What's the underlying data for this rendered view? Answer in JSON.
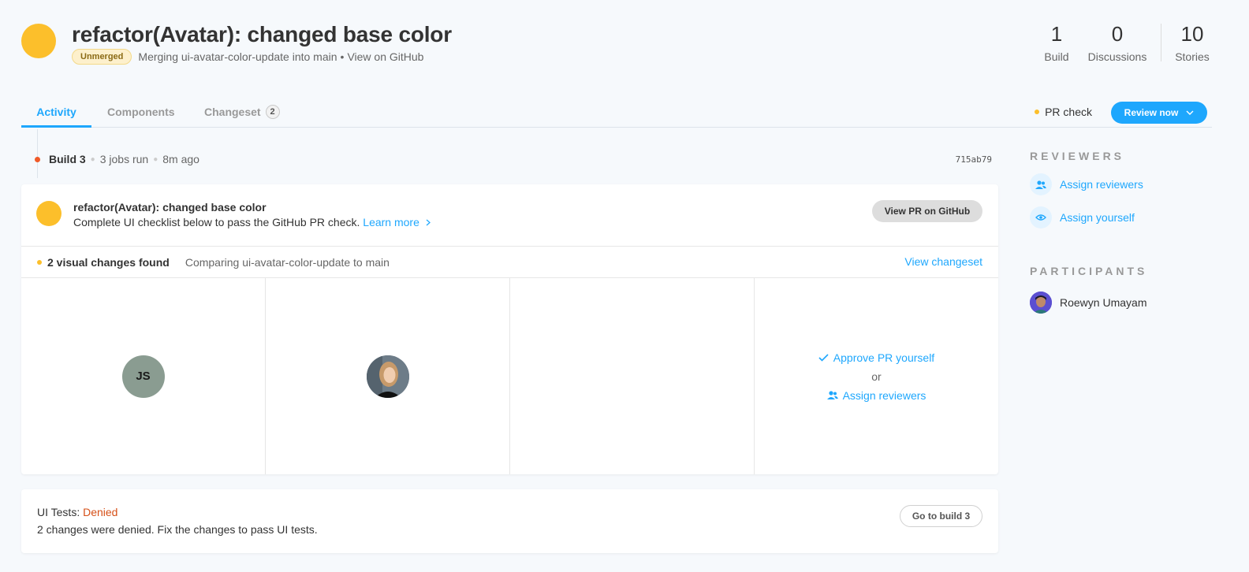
{
  "header": {
    "title": "refactor(Avatar): changed base color",
    "status_badge": "Unmerged",
    "merge_text": "Merging ui-avatar-color-update into main",
    "separator": "•",
    "github_link": "View on GitHub",
    "status_color": "#fcbf2b"
  },
  "stats": [
    {
      "value": "1",
      "label": "Build"
    },
    {
      "value": "0",
      "label": "Discussions"
    },
    {
      "value": "10",
      "label": "Stories"
    }
  ],
  "tabs": [
    {
      "label": "Activity",
      "active": true
    },
    {
      "label": "Components",
      "active": false
    },
    {
      "label": "Changeset",
      "active": false,
      "count": "2"
    }
  ],
  "toolbar": {
    "pr_check_label": "PR check",
    "review_button": "Review now"
  },
  "timeline": {
    "build_name": "Build 3",
    "jobs": "3 jobs run",
    "time": "8m ago",
    "commit_hash": "715ab79"
  },
  "pr_card": {
    "title": "refactor(Avatar): changed base color",
    "description": "Complete UI checklist below to pass the GitHub PR check.",
    "learn_more": "Learn more",
    "view_pr_button": "View PR on GitHub",
    "changes_found": "2 visual changes found",
    "comparison": "Comparing ui-avatar-color-update to main",
    "view_changeset": "View changeset",
    "avatar_initials": "JS",
    "approve_link": "Approve PR yourself",
    "or_text": "or",
    "assign_link": "Assign reviewers"
  },
  "tests_card": {
    "label": "UI Tests:",
    "status": "Denied",
    "description": "2 changes were denied. Fix the changes to pass UI tests.",
    "button": "Go to build 3"
  },
  "sidebar": {
    "reviewers_heading": "REVIEWERS",
    "assign_reviewers": "Assign reviewers",
    "assign_yourself": "Assign yourself",
    "participants_heading": "PARTICIPANTS",
    "participants": [
      {
        "name": "Roewyn Umayam"
      }
    ]
  },
  "colors": {
    "accent": "#1ea7fd",
    "warning": "#fcbf2b",
    "error": "#f05a28",
    "denied": "#d65018"
  }
}
